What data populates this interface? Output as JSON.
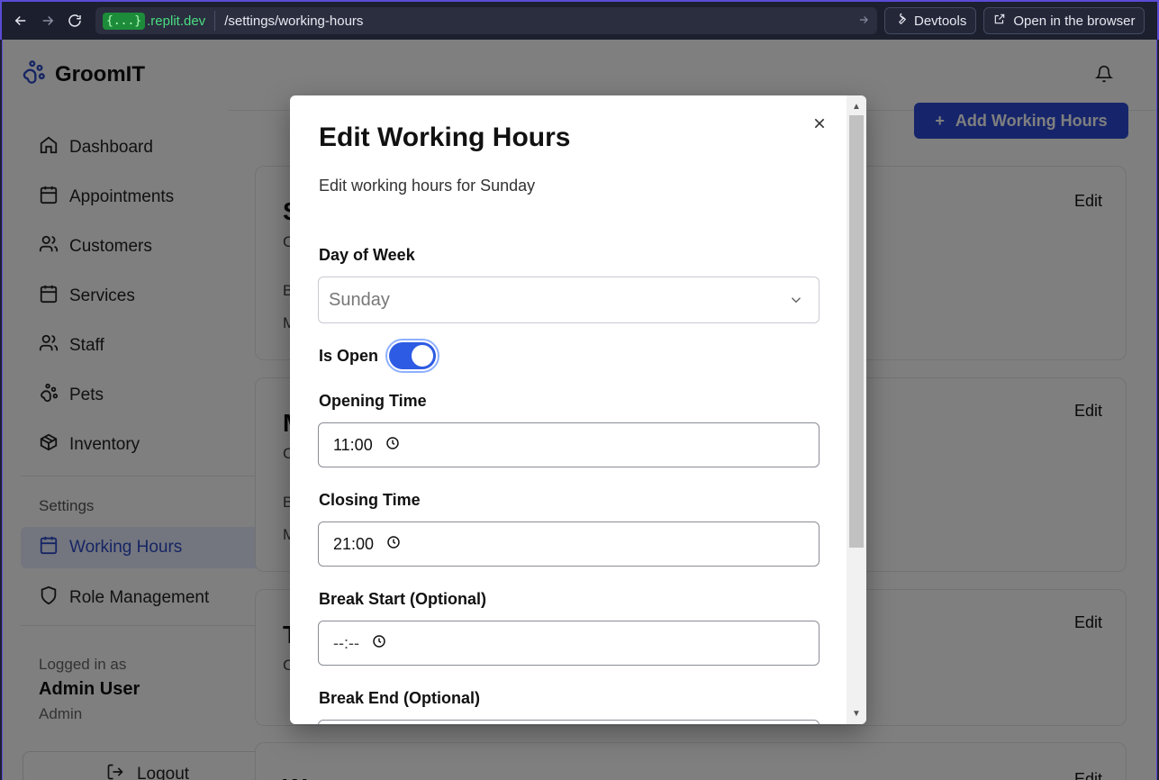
{
  "browser": {
    "badge": "{...}",
    "domain": ".replit.dev",
    "path": "/settings/working-hours",
    "devtools_label": "Devtools",
    "open_browser_label": "Open in the browser"
  },
  "app": {
    "brand": "GroomIT",
    "nav": [
      {
        "label": "Dashboard",
        "icon": "home-icon"
      },
      {
        "label": "Appointments",
        "icon": "calendar-icon"
      },
      {
        "label": "Customers",
        "icon": "users-icon"
      },
      {
        "label": "Services",
        "icon": "calendar-icon"
      },
      {
        "label": "Staff",
        "icon": "users-icon"
      },
      {
        "label": "Pets",
        "icon": "paw-icon"
      },
      {
        "label": "Inventory",
        "icon": "package-icon"
      }
    ],
    "settings_heading": "Settings",
    "settings_nav": [
      {
        "label": "Working Hours",
        "icon": "calendar-icon",
        "active": true
      },
      {
        "label": "Role Management",
        "icon": "shield-icon"
      }
    ],
    "user": {
      "logged_in_as": "Logged in as",
      "name": "Admin User",
      "role": "Admin"
    },
    "logout_label": "Logout",
    "add_button": "Add Working Hours",
    "cards": [
      {
        "title": "S",
        "sub": "C",
        "row1": "B",
        "row2": "M",
        "edit": "Edit"
      },
      {
        "title": "M",
        "sub": "C",
        "row1": "B",
        "row2": "M",
        "edit": "Edit"
      },
      {
        "title": "T",
        "sub": "C",
        "edit": "Edit"
      },
      {
        "title": "W",
        "edit": "Edit"
      }
    ]
  },
  "modal": {
    "title": "Edit Working Hours",
    "description": "Edit working hours for Sunday",
    "day_label": "Day of Week",
    "day_value": "Sunday",
    "is_open_label": "Is Open",
    "is_open": true,
    "opening_label": "Opening Time",
    "opening_value": "11:00",
    "closing_label": "Closing Time",
    "closing_value": "21:00",
    "break_start_label": "Break Start (Optional)",
    "break_start_value": "--:--",
    "break_end_label": "Break End (Optional)"
  },
  "colors": {
    "accent": "#2d5be3",
    "chrome_border": "#5a4bd6"
  }
}
